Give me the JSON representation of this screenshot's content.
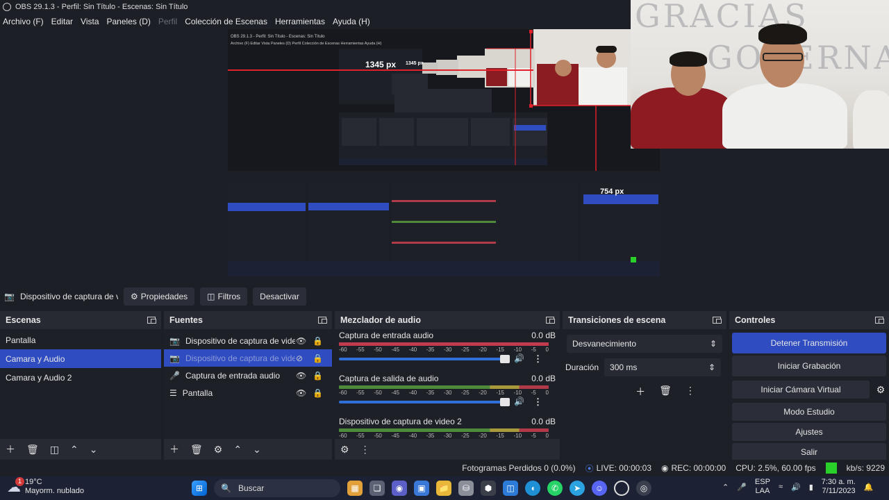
{
  "window": {
    "title": "OBS 29.1.3 - Perfil: Sin Título - Escenas: Sin Título"
  },
  "menu": [
    "Archivo (F)",
    "Editar",
    "Vista",
    "Paneles (D)",
    "Perfil",
    "Colección de Escenas",
    "Herramientas",
    "Ayuda (H)"
  ],
  "preview": {
    "measure_top": "1345 px",
    "measure_top_small": "1345 px",
    "measure_side": "754 px",
    "webcam_banner_1": "GRACIAS",
    "webcam_banner_2": "GOBERNADOR"
  },
  "source_toolbar": {
    "selected_source": "Dispositivo de captura de v",
    "properties": "Propiedades",
    "filters": "Filtros",
    "deactivate": "Desactivar"
  },
  "scenes": {
    "title": "Escenas",
    "items": [
      "Pantalla",
      "Camara y Audio",
      "Camara y Audio 2"
    ],
    "selected_index": 1
  },
  "sources": {
    "title": "Fuentes",
    "items": [
      {
        "label": "Dispositivo de captura de video",
        "icon": "camera-icon"
      },
      {
        "label": "Dispositivo de captura de video",
        "icon": "camera-icon"
      },
      {
        "label": "Captura de entrada audio",
        "icon": "microphone-icon"
      },
      {
        "label": "Pantalla",
        "icon": "list-icon"
      }
    ],
    "selected_index": 1
  },
  "mixer": {
    "title": "Mezclador de audio",
    "tracks": [
      {
        "name": "Captura de entrada audio",
        "level": "0.0 dB"
      },
      {
        "name": "Captura de salida de audio",
        "level": "0.0 dB"
      },
      {
        "name": "Dispositivo de captura de video 2",
        "level": "0.0 dB"
      }
    ],
    "scale": [
      "-60",
      "-55",
      "-50",
      "-45",
      "-40",
      "-35",
      "-30",
      "-25",
      "-20",
      "-15",
      "-10",
      "-5",
      "0"
    ]
  },
  "transitions": {
    "title": "Transiciones de escena",
    "selected": "Desvanecimiento",
    "duration_label": "Duración",
    "duration_value": "300 ms"
  },
  "controls": {
    "title": "Controles",
    "stop_stream": "Detener Transmisión",
    "start_recording": "Iniciar Grabación",
    "virtual_cam": "Iniciar Cámara Virtual",
    "studio_mode": "Modo Estudio",
    "settings": "Ajustes",
    "exit": "Salir"
  },
  "status": {
    "dropped_frames": "Fotogramas Perdidos 0 (0.0%)",
    "live": "LIVE: 00:00:03",
    "rec": "REC: 00:00:00",
    "cpu": "CPU: 2.5%, 60.00 fps",
    "kbs": "kb/s: 9229"
  },
  "taskbar": {
    "weather_temp": "19°C",
    "weather_desc": "Mayorm. nublado",
    "search": "Buscar",
    "lang_1": "ESP",
    "lang_2": "LAA",
    "time": "7:30 a. m.",
    "date": "7/11/2023",
    "notification_count": "1"
  },
  "colors": {
    "accent": "#2f4cc1",
    "live_green": "#2ad02a",
    "measure_red": "#e0202a"
  }
}
